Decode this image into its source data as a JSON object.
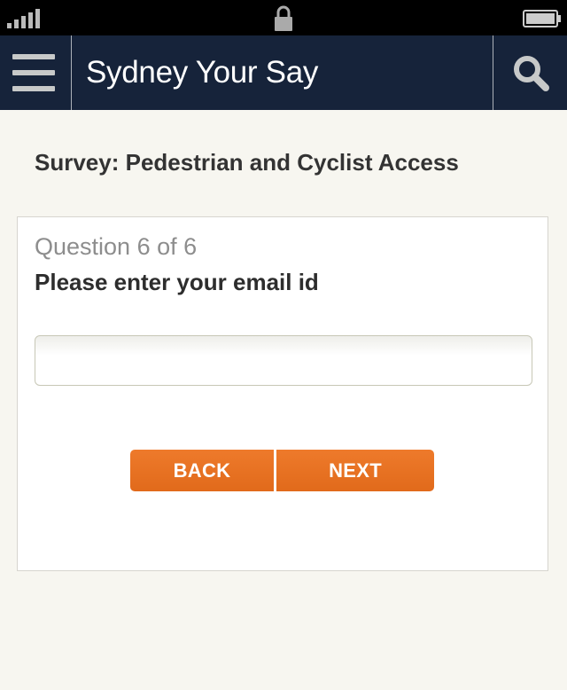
{
  "status_bar": {
    "signal_icon": "signal-strength-icon",
    "lock_icon": "lock-icon",
    "battery_icon": "battery-icon"
  },
  "header": {
    "menu_icon": "hamburger-menu-icon",
    "title": "Sydney Your Say",
    "search_icon": "search-icon",
    "background_color": "#16233a"
  },
  "survey": {
    "title": "Survey: Pedestrian and Cyclist Access"
  },
  "question": {
    "counter": "Question 6 of 6",
    "text": "Please enter your email id",
    "input_value": ""
  },
  "buttons": {
    "back_label": "BACK",
    "next_label": "NEXT",
    "accent_color": "#e8731f"
  }
}
